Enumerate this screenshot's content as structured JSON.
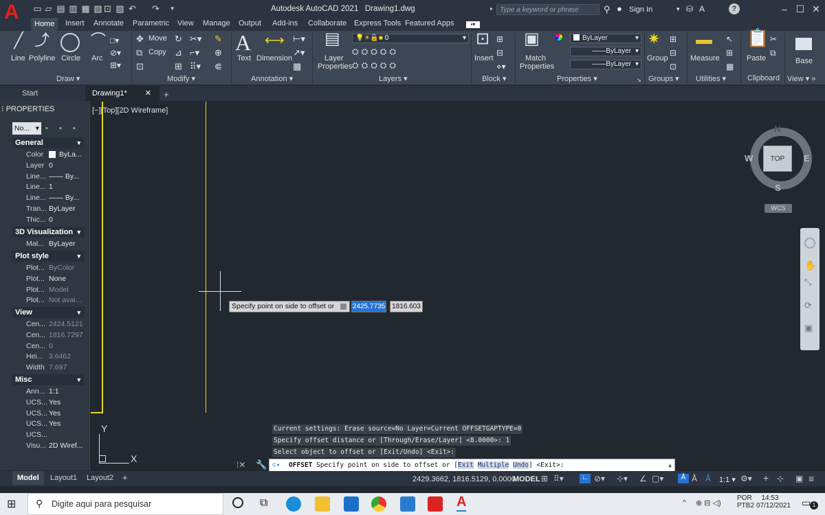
{
  "app": {
    "title": "Autodesk AutoCAD 2021",
    "drawing": "Drawing1.dwg",
    "search_placeholder": "Type a keyword or phrase",
    "signin": "Sign In"
  },
  "ribbon_tabs": [
    "Home",
    "Insert",
    "Annotate",
    "Parametric",
    "View",
    "Manage",
    "Output",
    "Add-ins",
    "Collaborate",
    "Express Tools",
    "Featured Apps"
  ],
  "ribbon": {
    "draw": {
      "title": "Draw",
      "line": "Line",
      "polyline": "Polyline",
      "circle": "Circle",
      "arc": "Arc"
    },
    "modify": {
      "title": "Modify",
      "move": "Move",
      "copy": "Copy"
    },
    "annotation": {
      "title": "Annotation",
      "text": "Text",
      "dimension": "Dimension"
    },
    "layers": {
      "title": "Layers",
      "layer_properties_1": "Layer",
      "layer_properties_2": "Properties",
      "current_layer": "0"
    },
    "block": {
      "title": "Block",
      "insert": "Insert"
    },
    "properties": {
      "title": "Properties",
      "match_1": "Match",
      "match_2": "Properties",
      "color": "ByLayer",
      "linetype": "ByLayer",
      "lineweight": "ByLayer"
    },
    "groups": {
      "title": "Groups",
      "group": "Group"
    },
    "utilities": {
      "title": "Utilities",
      "measure": "Measure"
    },
    "clipboard": {
      "title": "Clipboard",
      "paste": "Paste"
    },
    "view": {
      "title": "View",
      "base": "Base"
    }
  },
  "doc_tabs": {
    "start": "Start",
    "drawing": "Drawing1*"
  },
  "palette": {
    "title": "PROPERTIES",
    "selector": "No...",
    "sections": {
      "general": "General",
      "visualization": "3D Visualization",
      "plotstyle": "Plot style",
      "view": "View",
      "misc": "Misc"
    },
    "general": [
      {
        "k": "Color",
        "v": "ByLa..."
      },
      {
        "k": "Layer",
        "v": "0"
      },
      {
        "k": "Line...",
        "v": "—— By..."
      },
      {
        "k": "Line...",
        "v": "1"
      },
      {
        "k": "Line...",
        "v": "—— By..."
      },
      {
        "k": "Tran...",
        "v": "ByLayer"
      },
      {
        "k": "Thic...",
        "v": "0"
      }
    ],
    "visualization": [
      {
        "k": "Mat...",
        "v": "ByLayer"
      }
    ],
    "plotstyle": [
      {
        "k": "Plot...",
        "v": "ByColor"
      },
      {
        "k": "Plot...",
        "v": "None"
      },
      {
        "k": "Plot...",
        "v": "Model"
      },
      {
        "k": "Plot...",
        "v": "Not avai..."
      }
    ],
    "view": [
      {
        "k": "Cen...",
        "v": "2424.5121"
      },
      {
        "k": "Cen...",
        "v": "1816.7297"
      },
      {
        "k": "Cen...",
        "v": "0"
      },
      {
        "k": "Hei...",
        "v": "3.6462"
      },
      {
        "k": "Width",
        "v": "7.697"
      }
    ],
    "misc": [
      {
        "k": "Ann...",
        "v": "1:1"
      },
      {
        "k": "UCS...",
        "v": "Yes"
      },
      {
        "k": "UCS...",
        "v": "Yes"
      },
      {
        "k": "UCS...",
        "v": "Yes"
      },
      {
        "k": "UCS...",
        "v": ""
      },
      {
        "k": "Visu...",
        "v": "2D Wiref..."
      }
    ]
  },
  "viewport": {
    "label": "[−][Top][2D Wireframe]",
    "viewcube": {
      "top": "TOP",
      "n": "N",
      "s": "S",
      "e": "E",
      "w": "W",
      "wcs": "WCS"
    },
    "ucs_y": "Y",
    "ucs_x": "X"
  },
  "dynamic_input": {
    "prompt": "Specify point on side to offset or",
    "x": "2425.7735",
    "y": "1816.603"
  },
  "command": {
    "history": [
      "Current settings: Erase source=No  Layer=Current  OFFSETGAPTYPE=0",
      "Specify offset distance or [Through/Erase/Layer] <8.0000>: 1",
      "Select object to offset or [Exit/Undo] <Exit>:"
    ],
    "prompt_cmd": "OFFSET",
    "prompt_text": "Specify point on side to offset or [",
    "opt_exit": "Exit",
    "opt_multiple": "Multiple",
    "opt_undo": "Undo",
    "prompt_end": "] <Exit>:"
  },
  "layout_tabs": [
    "Model",
    "Layout1",
    "Layout2"
  ],
  "status": {
    "coords": "2429.3662, 1816.5129, 0.0000",
    "model": "MODEL",
    "scale": "1:1"
  },
  "taskbar": {
    "search": "Digite aqui para pesquisar",
    "lang1": "POR",
    "lang2": "PTB2",
    "time": "14:53",
    "date": "07/12/2021",
    "notif": "1"
  },
  "colors": {
    "viewport_bg": "#212830",
    "yellow_line": "#e5d62a",
    "accent_blue": "#2673d4",
    "logo_red": "#e02020"
  }
}
